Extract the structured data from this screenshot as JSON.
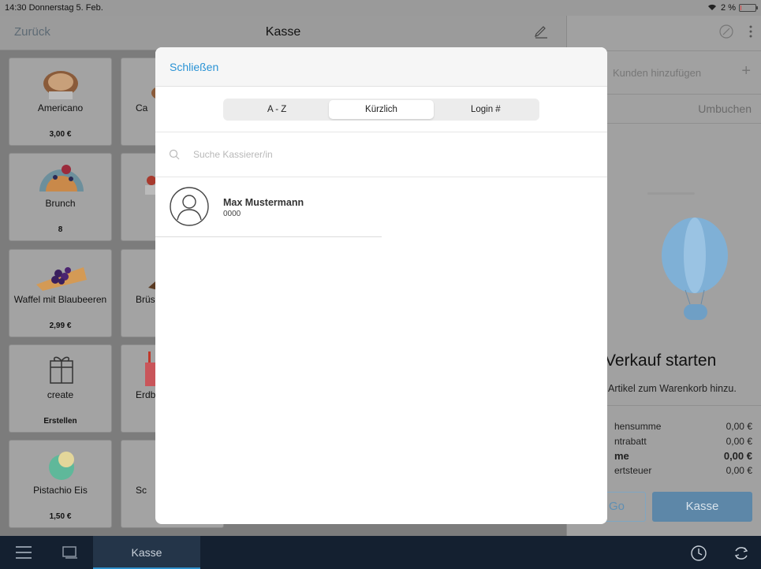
{
  "status_bar": {
    "time": "14:30",
    "date": "Donnerstag 5. Feb.",
    "battery": "2 %",
    "battery_level": 0.02
  },
  "nav": {
    "back_label": "Zurück",
    "title": "Kasse",
    "edit_icon": "pencil-icon"
  },
  "products": [
    {
      "name": "Americano",
      "price": "3,00 €",
      "icon": "coffee-cup-icon"
    },
    {
      "name": "Ca",
      "price": "",
      "icon": "coffee-icon"
    },
    {
      "name": "Brunch",
      "price": "8",
      "icon": "waffle-icon"
    },
    {
      "name": "",
      "price": "",
      "icon": "dessert-icon"
    },
    {
      "name": "Waffel mit Blaubeeren",
      "price": "2,99 €",
      "icon": "waffle-blueberry-icon"
    },
    {
      "name": "Brüss",
      "price": "",
      "icon": "waffle-icon"
    },
    {
      "name": "create",
      "price": "Erstellen",
      "icon": "gift-icon"
    },
    {
      "name": "Erdbe",
      "price": "",
      "icon": "drink-icon"
    },
    {
      "name": "Pistachio Eis",
      "price": "1,50 €",
      "icon": "ice-cream-icon"
    },
    {
      "name": "Sc",
      "price": "",
      "icon": "dessert-icon"
    }
  ],
  "right_panel": {
    "customer_placeholder": "Kunden hinzufügen",
    "rebook_label": "Umbuchen",
    "start_title": "Verkauf starten",
    "start_hint": "Artikel zum Warenkorb hinzu.",
    "totals": [
      {
        "label": "hensumme",
        "value": "0,00 €",
        "bold": false
      },
      {
        "label": "ntrabatt",
        "value": "0,00 €",
        "bold": false
      },
      {
        "label": "me",
        "value": "0,00 €",
        "bold": true
      },
      {
        "label": "ertsteuer",
        "value": "0,00 €",
        "bold": false
      }
    ],
    "go_button": "Go",
    "checkout_button": "Kasse"
  },
  "tabbar": {
    "kasse_label": "Kasse"
  },
  "modal": {
    "close_label": "Schließen",
    "segments": [
      {
        "label": "A - Z",
        "active": false
      },
      {
        "label": "Kürzlich",
        "active": true
      },
      {
        "label": "Login #",
        "active": false
      }
    ],
    "search_placeholder": "Suche Kassierer/in",
    "cashiers": [
      {
        "name": "Max Mustermann",
        "id": "0000"
      }
    ]
  },
  "colors": {
    "accent": "#2a93d5",
    "tabbar_bg": "#142030",
    "active_tab_underline": "#2d8ec9"
  }
}
